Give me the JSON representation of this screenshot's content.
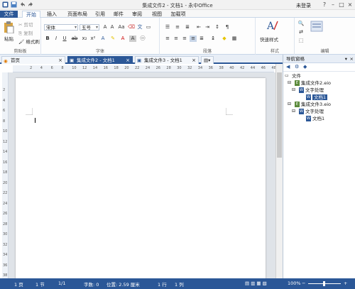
{
  "window": {
    "title": "集成文件2 - 文档1 - 永中Office",
    "login": "未登录"
  },
  "menu": {
    "file": "文件",
    "items": [
      "开始",
      "插入",
      "页面布局",
      "引用",
      "邮件",
      "审阅",
      "视图",
      "加载项"
    ]
  },
  "ribbon": {
    "clipboard": {
      "label": "剪贴板",
      "paste": "粘贴",
      "cut": "剪切",
      "copy": "复制",
      "format_painter": "格式刷"
    },
    "font": {
      "label": "字体",
      "font_name": "宋体",
      "font_size": "五号",
      "bold": "B",
      "italic": "I",
      "underline": "U"
    },
    "paragraph": {
      "label": "段落"
    },
    "style": {
      "label": "样式",
      "quick_style": "快速样式"
    },
    "edit": {
      "label": "编辑"
    }
  },
  "tabs": [
    {
      "label": "首页"
    },
    {
      "label": "集成文件2 - 文档1"
    },
    {
      "label": "集成文件3 - 文档1"
    }
  ],
  "ruler": [
    "2",
    "4",
    "6",
    "8",
    "10",
    "12",
    "14",
    "16",
    "18",
    "20",
    "22",
    "24",
    "26",
    "28",
    "30",
    "32",
    "34",
    "36",
    "38",
    "40",
    "42",
    "44",
    "46",
    "48"
  ],
  "vruler": [
    "2",
    "4",
    "6",
    "8",
    "10",
    "12",
    "14",
    "16",
    "18",
    "20",
    "22",
    "24",
    "26",
    "28",
    "30",
    "32",
    "34",
    "36",
    "38"
  ],
  "nav": {
    "title": "导航窗格",
    "tree": [
      {
        "label": "文件",
        "level": 0
      },
      {
        "label": "集成文件2.eio",
        "level": 1
      },
      {
        "label": "文字处理",
        "level": 2
      },
      {
        "label": "文档1",
        "level": 3,
        "selected": true
      },
      {
        "label": "集成文件3.eio",
        "level": 1
      },
      {
        "label": "文字处理",
        "level": 2
      },
      {
        "label": "文档1",
        "level": 3
      }
    ]
  },
  "status": {
    "page": "1 页",
    "section": "1 节",
    "pages": "1/1",
    "words": "字数: 0",
    "position": "位置: 2.59 厘米",
    "line": "1 行",
    "col": "1 列",
    "zoom": "100%"
  },
  "colors": {
    "accent": "#2b5797"
  }
}
